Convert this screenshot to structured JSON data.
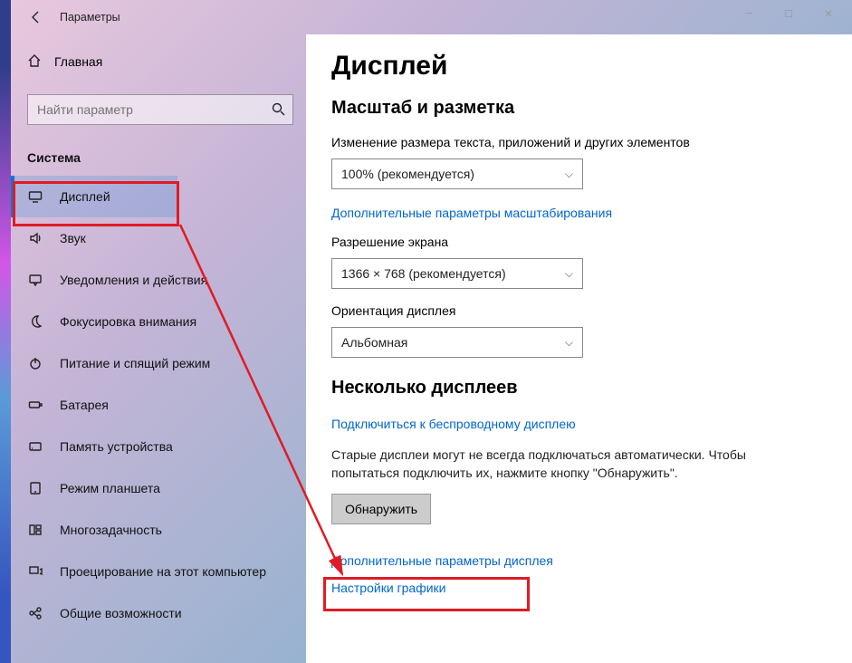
{
  "titlebar": {
    "app_name": "Параметры"
  },
  "sidebar": {
    "home_label": "Главная",
    "search_placeholder": "Найти параметр",
    "section_label": "Система",
    "items": [
      {
        "label": "Дисплей"
      },
      {
        "label": "Звук"
      },
      {
        "label": "Уведомления и действия"
      },
      {
        "label": "Фокусировка внимания"
      },
      {
        "label": "Питание и спящий режим"
      },
      {
        "label": "Батарея"
      },
      {
        "label": "Память устройства"
      },
      {
        "label": "Режим планшета"
      },
      {
        "label": "Многозадачность"
      },
      {
        "label": "Проецирование на этот компьютер"
      },
      {
        "label": "Общие возможности"
      }
    ]
  },
  "content": {
    "page_title": "Дисплей",
    "scale_section": "Масштаб и разметка",
    "scale_label": "Изменение размера текста, приложений и других элементов",
    "scale_value": "100% (рекомендуется)",
    "scale_link": "Дополнительные параметры масштабирования",
    "resolution_label": "Разрешение экрана",
    "resolution_value": "1366 × 768 (рекомендуется)",
    "orientation_label": "Ориентация дисплея",
    "orientation_value": "Альбомная",
    "multi_section": "Несколько дисплеев",
    "wireless_link": "Подключиться к беспроводному дисплею",
    "multi_hint": "Старые дисплеи могут не всегда подключаться автоматически. Чтобы попытаться подключить их, нажмите кнопку \"Обнаружить\".",
    "detect_button": "Обнаружить",
    "adv_display_link": "Дополнительные параметры дисплея",
    "graphics_link": "Настройки графики"
  }
}
